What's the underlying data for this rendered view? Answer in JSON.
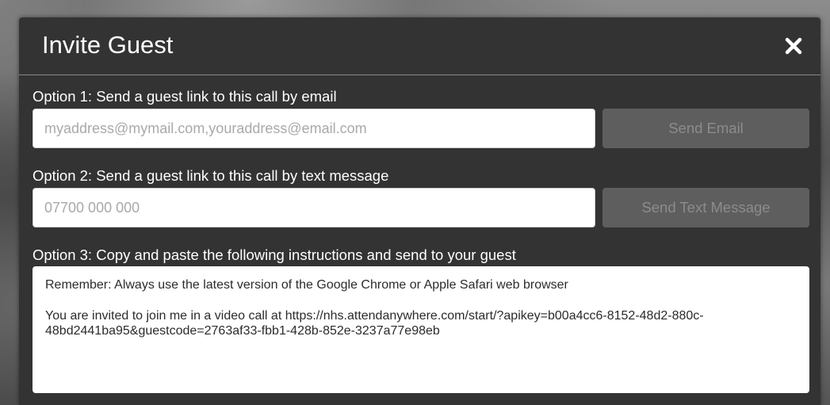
{
  "dialog": {
    "title": "Invite Guest",
    "close_icon": "close-icon"
  },
  "option1": {
    "label": "Option 1: Send a guest link to this call by email",
    "email_placeholder": "myaddress@mymail.com,youraddress@email.com",
    "email_value": "",
    "button_label": "Send Email"
  },
  "option2": {
    "label": "Option 2: Send a guest link to this call by text message",
    "phone_placeholder": "07700 000 000",
    "phone_value": "",
    "button_label": "Send Text Message"
  },
  "option3": {
    "label": "Option 3: Copy and paste the following instructions and send to your guest",
    "line1": "Remember: Always use the latest version of the Google Chrome or Apple Safari web browser",
    "line2": "You are invited to join me in a video call at https://nhs.attendanywhere.com/start/?apikey=b00a4cc6-8152-48d2-880c-48bd2441ba95&guestcode=2763af33-fbb1-428b-852e-3237a77e98eb"
  },
  "colors": {
    "dialog_bg": "#333333",
    "button_disabled_bg": "#5e5e5e",
    "button_disabled_text": "#8c8c8c"
  }
}
